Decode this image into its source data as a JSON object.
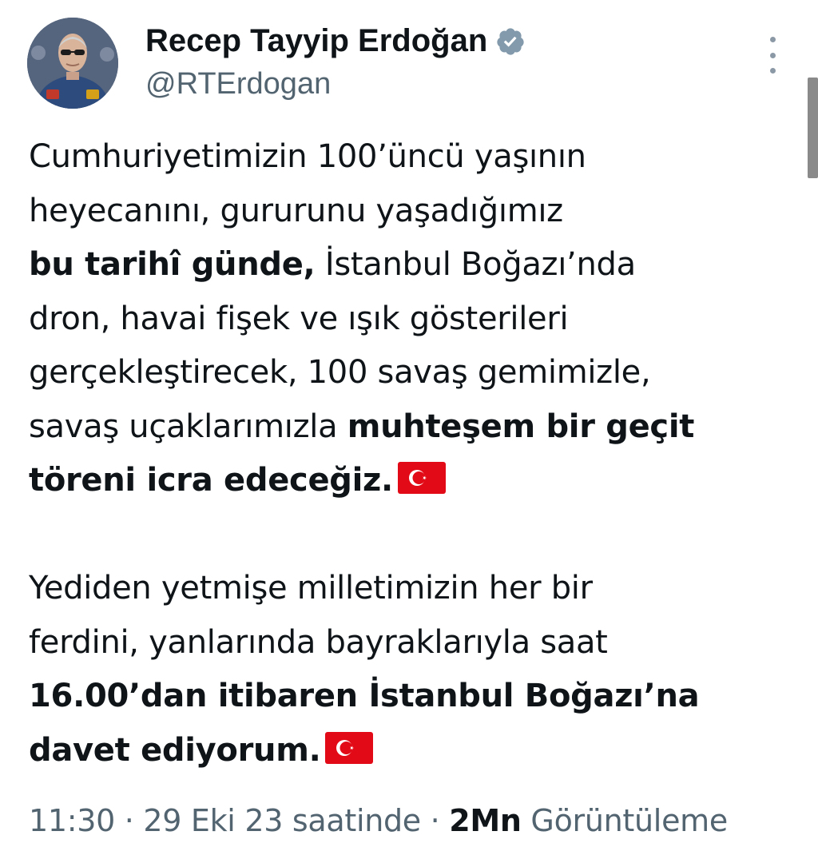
{
  "author": {
    "display_name": "Recep Tayyip Erdoğan",
    "handle": "@RTErdogan",
    "verified_icon": "verified-badge-icon",
    "avatar": "profile-photo"
  },
  "tweet": {
    "paragraph1": {
      "line1": "Cumhuriyetimizin 100’üncü yaşının",
      "line2": "heyecanını, gururunu yaşadığımız",
      "line3_bold": "bu tarihî günde,",
      "line3_rest": " İstanbul Boğazı’nda",
      "line4": "dron, havai fişek ve ışık gösterileri",
      "line5": "gerçekleştirecek, 100 savaş gemimizle,",
      "line6_rest": "savaş uçaklarımızla ",
      "line6_bold": "muhteşem bir geçit",
      "line7_bold": "töreni icra edeceğiz.",
      "flag_emoji": "turkey-flag-icon"
    },
    "paragraph2": {
      "line1": "Yediden yetmişe milletimizin her bir",
      "line2": "ferdini, yanlarında bayraklarıyla saat",
      "line3_bold": "16.00’dan itibaren İstanbul Boğazı’na",
      "line4_bold": "davet ediyorum.",
      "flag_emoji": "turkey-flag-icon"
    }
  },
  "meta": {
    "time": "11:30",
    "separator": " · ",
    "date": "29 Eki 23 saatinde",
    "views_count": "2Mn",
    "views_label": " Görüntüleme"
  },
  "colors": {
    "text_primary": "#0f1419",
    "text_secondary": "#536471",
    "verified_badge": "#829aab",
    "flag_red": "#e30a17"
  }
}
